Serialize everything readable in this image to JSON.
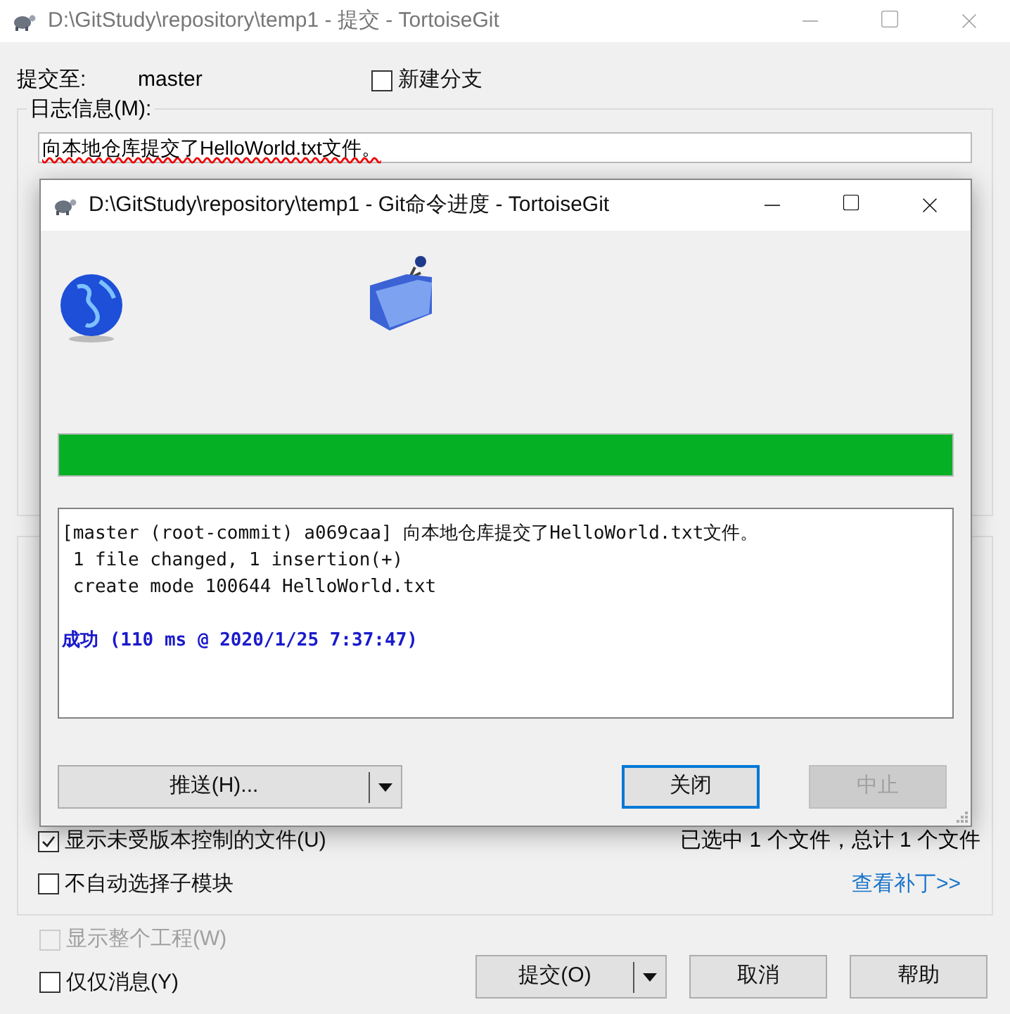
{
  "window": {
    "title": "D:\\GitStudy\\repository\\temp1 - 提交 - TortoiseGit"
  },
  "commit_to": {
    "label": "提交至:",
    "branch": "master"
  },
  "new_branch": {
    "label": "新建分支",
    "checked": false
  },
  "log_message": {
    "label": "日志信息(M):",
    "value": "向本地仓库提交了HelloWorld.txt文件。"
  },
  "options": [
    {
      "label": "显示未受版本控制的文件(U)",
      "checked": true,
      "disabled": false
    },
    {
      "label": "不自动选择子模块",
      "checked": false,
      "disabled": false
    }
  ],
  "selection_summary": "已选中 1 个文件，总计 1 个文件",
  "view_patch_link": "查看补丁>>",
  "bottom_options": [
    {
      "label": "显示整个工程(W)",
      "checked": false,
      "disabled": true
    },
    {
      "label": "仅仅消息(Y)",
      "checked": false,
      "disabled": false
    }
  ],
  "buttons": [
    {
      "label": "提交(O)",
      "kind": "split"
    },
    {
      "label": "取消",
      "kind": "plain"
    },
    {
      "label": "帮助",
      "kind": "plain"
    }
  ],
  "progress_dialog": {
    "title": "D:\\GitStudy\\repository\\temp1 - Git命令进度 - TortoiseGit",
    "progress": {
      "level": 1
    },
    "log": [
      {
        "text": "[master (root-commit) a069caa] 向本地仓库提交了HelloWorld.txt文件。",
        "kind": "output"
      },
      {
        "text": " 1 file changed, 1 insertion(+)",
        "kind": "output"
      },
      {
        "text": " create mode 100644 HelloWorld.txt",
        "kind": "output"
      },
      {
        "text": "成功 (110 ms @ 2020/1/25 7:37:47)",
        "kind": "success"
      }
    ],
    "buttons": [
      {
        "label": "推送(H)...",
        "kind": "split",
        "default": false,
        "disabled": false
      },
      {
        "label": "关闭",
        "kind": "plain",
        "default": true,
        "disabled": false
      },
      {
        "label": "中止",
        "kind": "plain",
        "default": false,
        "disabled": true
      }
    ]
  }
}
